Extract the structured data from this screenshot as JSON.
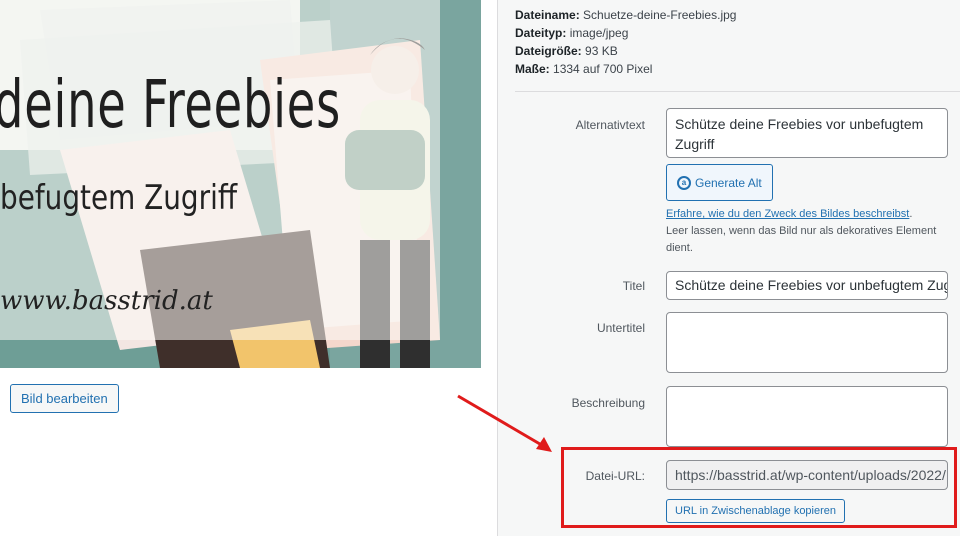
{
  "preview": {
    "title_line": "deine Freebies",
    "subtitle_line": "befugtem Zugriff",
    "url_line": "www.basstrid.at",
    "edit_button": "Bild bearbeiten"
  },
  "details": {
    "filename_label": "Dateiname:",
    "filename_value": "Schuetze-deine-Freebies.jpg",
    "filetype_label": "Dateityp:",
    "filetype_value": "image/jpeg",
    "filesize_label": "Dateigröße:",
    "filesize_value": "93 KB",
    "dimensions_label": "Maße:",
    "dimensions_value": "1334 auf 700 Pixel"
  },
  "form": {
    "alt_label": "Alternativtext",
    "alt_value": "Schütze deine Freebies vor unbefugtem Zugriff",
    "generate_alt_label": "Generate Alt",
    "help_link": "Erfahre, wie du den Zweck des Bildes beschreibst",
    "help_text": "Leer lassen, wenn das Bild nur als dekoratives Element dient.",
    "title_label": "Titel",
    "title_value": "Schütze deine Freebies vor unbefugtem Zugriff",
    "caption_label": "Untertitel",
    "caption_value": "",
    "description_label": "Beschreibung",
    "description_value": "",
    "url_label": "Datei-URL:",
    "url_value": "https://basstrid.at/wp-content/uploads/2022/",
    "copy_button": "URL in Zwischenablage kopieren"
  },
  "colors": {
    "accent": "#2271b1",
    "annotation": "#e01b1b",
    "panel_bg": "#f6f7f7"
  }
}
